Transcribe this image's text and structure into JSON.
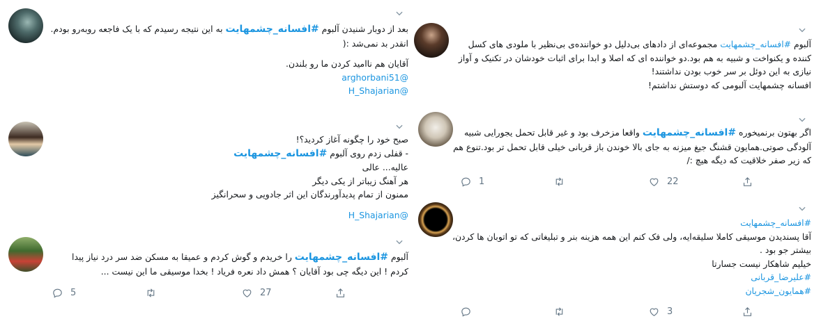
{
  "tweets": [
    {
      "id": "t1",
      "lines": [
        {
          "segments": [
            {
              "text": "بعد از دوبار شنیدن آلبوم "
            },
            {
              "text": "#افسانه_چشمهایت",
              "style": "hashtag"
            },
            {
              "text": " به این نتیجه رسیدم که با یک فاجعه روبه‌رو بودم."
            }
          ]
        },
        {
          "segments": [
            {
              "text": "انقدر بد نمی‌شد :("
            }
          ]
        },
        {
          "blank": true
        },
        {
          "segments": [
            {
              "text": "آقایان هم ناامید کردن ما رو بلندن."
            }
          ]
        },
        {
          "segments": [
            {
              "text": "@arghorbani51",
              "style": "link"
            }
          ]
        },
        {
          "segments": [
            {
              "text": "@H_Shajarian",
              "style": "link"
            }
          ]
        }
      ]
    },
    {
      "id": "t2",
      "lines": [
        {
          "segments": [
            {
              "text": "صبح خود را چگونه آغاز کردید؟!"
            }
          ]
        },
        {
          "segments": [
            {
              "text": "- قفلی زدم روی آلبوم "
            },
            {
              "text": "#افسانه_چشمهایت",
              "style": "hashtag"
            }
          ]
        },
        {
          "segments": [
            {
              "text": "عالیه... عالی"
            }
          ]
        },
        {
          "segments": [
            {
              "text": "هر آهنگ زیباتر از یکی دیگر"
            }
          ]
        },
        {
          "segments": [
            {
              "text": "ممنون از تمام پدیدآورندگان این اثر جادویی و سحرانگیز"
            }
          ]
        },
        {
          "blank": true
        },
        {
          "segments": [
            {
              "text": "@H_Shajarian",
              "style": "link"
            }
          ]
        }
      ]
    },
    {
      "id": "t3",
      "lines": [
        {
          "segments": [
            {
              "text": "آلبوم "
            },
            {
              "text": "#افسانه_چشمهایت",
              "style": "hashtag"
            },
            {
              "text": " را خریدم و گوش کردم و عمیقا به مسکن ضد سر درد نیاز پیدا"
            }
          ]
        },
        {
          "segments": [
            {
              "text": "کردم ! این دیگه چی بود آقایان ؟ همش داد نعره فریاد ! بخدا موسیقی ما این نیست ..."
            }
          ]
        }
      ],
      "actions": {
        "reply": "5",
        "retweet": "",
        "like": "27"
      }
    },
    {
      "id": "t4",
      "lines": [
        {
          "segments": [
            {
              "text": "آلبوم "
            },
            {
              "text": "#افسانه_چشمهایت",
              "style": "link"
            },
            {
              "text": " مجموعه‌ای از دادهای بی‌دلیل دو خواننده‌ی بی‌نظیر با ملودی های کسل"
            }
          ]
        },
        {
          "segments": [
            {
              "text": "کننده و یکنواخت و شبیه به هم بود.دو خواننده ای که اصلا و ابدا برای اثبات خودشان در تکنیک و آواز"
            }
          ]
        },
        {
          "segments": [
            {
              "text": "نیازی به این دوئل بر سر خوب بودن نداشتند!"
            }
          ]
        },
        {
          "segments": [
            {
              "text": "افسانه چشمهایت آلبومی که دوستش نداشتم!"
            }
          ]
        }
      ]
    },
    {
      "id": "t5",
      "lines": [
        {
          "segments": [
            {
              "text": "اگر بهتون برنمیخوره "
            },
            {
              "text": "#افسانه_چشمهایت",
              "style": "hashtag"
            },
            {
              "text": " واقعا مزخرف بود و غیر قابل تحمل یجورایی شبیه"
            }
          ]
        },
        {
          "segments": [
            {
              "text": "آلودگی صوتی.همایون قشنگ جیغ میزنه به جای بالا خوندن باز قربانی خیلی قابل تحمل تر بود.تنوع هم"
            }
          ]
        },
        {
          "segments": [
            {
              "text": "که زیر صفر خلاقیت که دیگه هیچ :/"
            }
          ]
        }
      ],
      "actions": {
        "reply": "1",
        "retweet": "",
        "like": "22"
      }
    },
    {
      "id": "t6",
      "lines": [
        {
          "segments": [
            {
              "text": "#افسانه_چشمهایت",
              "style": "link"
            }
          ]
        },
        {
          "segments": [
            {
              "text": "آقا پسندیدن موسیقی کاملا سلیقه‌ایه، ولی فک کنم این همه هزینه بنر و تبلیغاتی که تو اتوبان ها کردن،"
            }
          ]
        },
        {
          "segments": [
            {
              "text": "بیشتر جو بود ."
            }
          ]
        },
        {
          "segments": [
            {
              "text": "خیلیم شاهکار نیست جسارتا"
            }
          ]
        },
        {
          "segments": [
            {
              "text": "#علیرضا_قربانی",
              "style": "link"
            }
          ]
        },
        {
          "segments": [
            {
              "text": "#همایون_شجریان",
              "style": "link"
            }
          ]
        }
      ],
      "actions": {
        "reply": "",
        "retweet": "",
        "like": "3"
      }
    }
  ],
  "icons": {
    "chevron": "chevron-down-icon",
    "reply": "reply-icon",
    "retweet": "retweet-icon",
    "like": "heart-icon",
    "share": "share-icon"
  },
  "colors": {
    "link": "#1b95e0",
    "icon": "#657786",
    "text": "#14171a"
  }
}
